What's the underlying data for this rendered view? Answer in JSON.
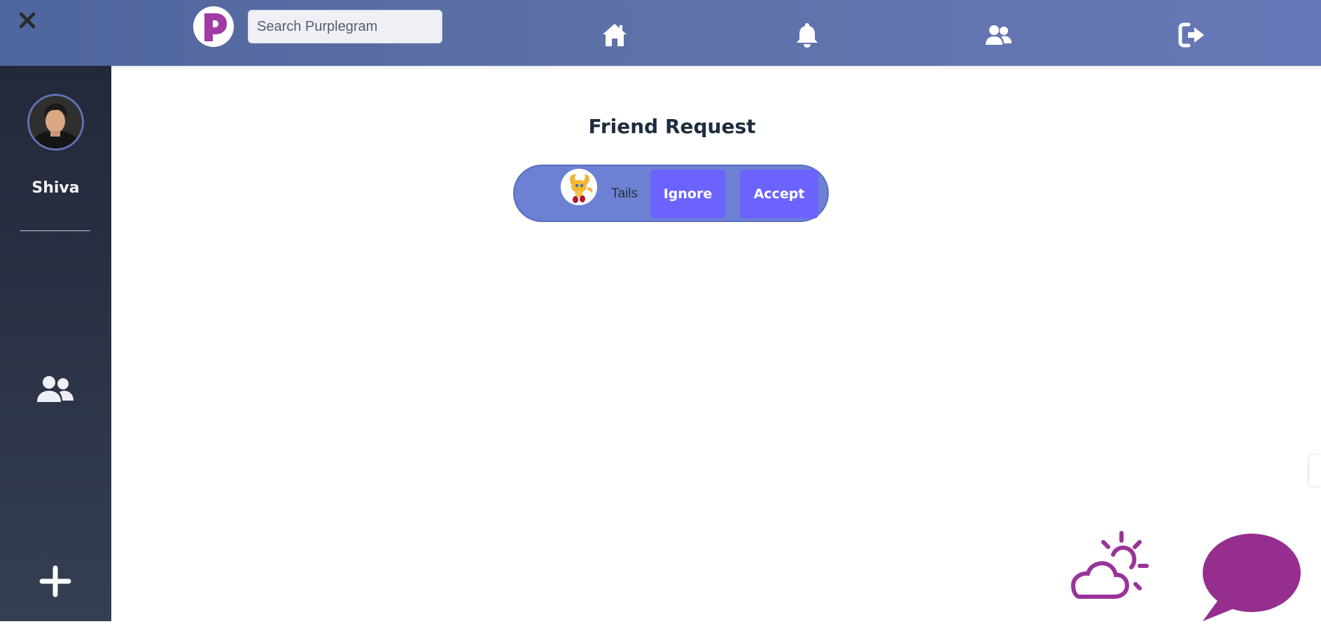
{
  "header": {
    "search": {
      "placeholder": "Search Purplegram",
      "value": ""
    },
    "nav": [
      "home-icon",
      "bell-icon",
      "friends-icon",
      "logout-icon"
    ]
  },
  "sidebar": {
    "user_name": "Shiva",
    "items": [
      "friends-icon",
      "plus-icon"
    ]
  },
  "main": {
    "title": "Friend Request",
    "requests": [
      {
        "name": "Tails",
        "ignore_label": "Ignore",
        "accept_label": "Accept"
      }
    ]
  },
  "colors": {
    "topbar": "#5d72a8",
    "sidebar": "#2a3043",
    "card": "#6c81d3",
    "button": "#6c63ff",
    "accent": "#993399"
  }
}
